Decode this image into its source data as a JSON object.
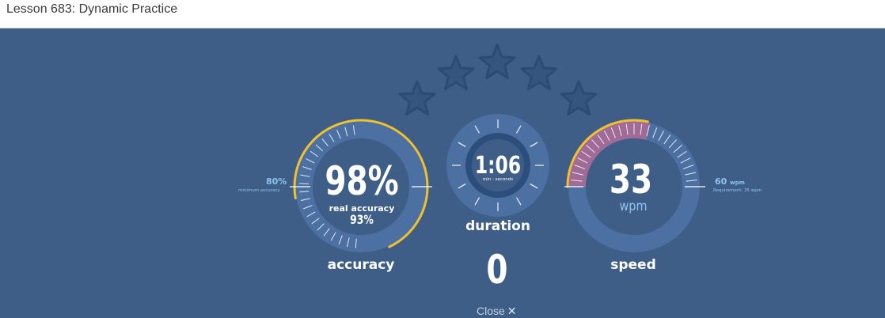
{
  "window": {
    "title": "Lesson 683: Dynamic Practice"
  },
  "colors": {
    "background": "#3e5e87",
    "ring": "#4b70a1",
    "ring_dark": "#2b4e7c",
    "accent_yellow": "#f0c02f",
    "speed_fill": "#a06b96",
    "star_fill": "#35557f",
    "tick": "#ffffff",
    "label_blue": "#8fc4ef"
  },
  "stars": {
    "total": 5,
    "earned": 0
  },
  "accuracy": {
    "value": "98%",
    "fraction": 0.98,
    "real_label": "real accuracy",
    "real_value": "93%",
    "min_value": "80%",
    "min_label": "minimum accuracy",
    "label": "accuracy"
  },
  "duration": {
    "value": "1:06",
    "unit_label": "min : seconds",
    "label": "duration"
  },
  "errors": {
    "value": "0"
  },
  "speed": {
    "value": "33",
    "unit": "wpm",
    "fraction": 0.55,
    "target_value": "60",
    "target_unit": "wpm",
    "requirement_label": "Requirement: 35 wpm",
    "label": "speed"
  },
  "close": {
    "label": "Close",
    "icon": "close-icon"
  }
}
